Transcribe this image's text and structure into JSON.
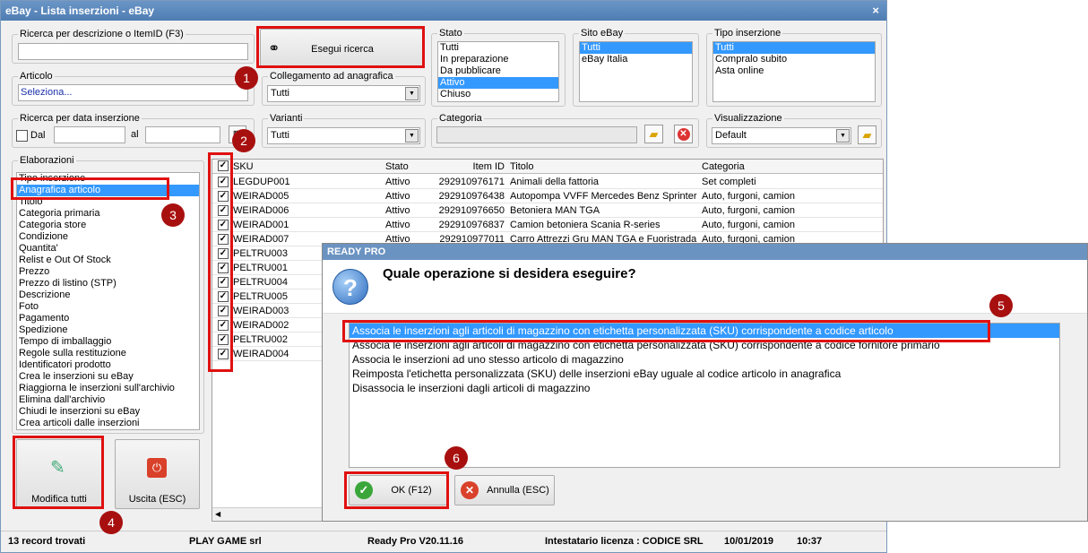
{
  "window": {
    "title": "eBay - Lista inserzioni - eBay",
    "close": "×"
  },
  "search": {
    "desc_label": "Ricerca per descrizione o ItemID (F3)",
    "desc_value": "",
    "exec_button": "Esegui ricerca",
    "articolo_label": "Articolo",
    "articolo_value": "Seleziona...",
    "date_label": "Ricerca per data inserzione",
    "dal_label": "Dal",
    "al_label": "al"
  },
  "collegamento": {
    "label": "Collegamento ad anagrafica",
    "value": "Tutti"
  },
  "varianti": {
    "label": "Varianti",
    "value": "Tutti"
  },
  "stato": {
    "label": "Stato",
    "items": [
      "Tutti",
      "In preparazione",
      "Da pubblicare",
      "Attivo",
      "Chiuso"
    ],
    "selected": 3
  },
  "sito": {
    "label": "Sito eBay",
    "items": [
      "Tutti",
      "eBay Italia"
    ],
    "selected": 0
  },
  "tipo": {
    "label": "Tipo inserzione",
    "items": [
      "Tutti",
      "Compralo subito",
      "Asta online"
    ],
    "selected": 0
  },
  "categoria": {
    "label": "Categoria",
    "value": ""
  },
  "visualizzazione": {
    "label": "Visualizzazione",
    "value": "Default"
  },
  "elaborazioni": {
    "label": "Elaborazioni",
    "items": [
      "Tipo inserzione",
      "Anagrafica articolo",
      "Titolo",
      "Categoria primaria",
      "Categoria store",
      "Condizione",
      "Quantita'",
      "Relist e Out Of Stock",
      "Prezzo",
      "Prezzo di listino (STP)",
      "Descrizione",
      "Foto",
      "Pagamento",
      "Spedizione",
      "Tempo di imballaggio",
      "Regole sulla restituzione",
      "Identificatori prodotto",
      "Crea le inserzioni su eBay",
      "Riaggiorna le inserzioni sull'archivio",
      "Elimina dall'archivio",
      "Chiudi le inserzioni su eBay",
      "Crea articoli dalle inserzioni"
    ],
    "selected": 1
  },
  "buttons": {
    "modifica": "Modifica tutti",
    "uscita": "Uscita (ESC)"
  },
  "grid": {
    "headers": [
      "SKU",
      "Stato",
      "Item ID",
      "Titolo",
      "Categoria"
    ],
    "rows": [
      [
        "LEGDUP001",
        "Attivo",
        "292910976171",
        "Animali della fattoria",
        "Set completi"
      ],
      [
        "WEIRAD005",
        "Attivo",
        "292910976438",
        "Autopompa VVFF Mercedes Benz Sprinter",
        "Auto, furgoni, camion"
      ],
      [
        "WEIRAD006",
        "Attivo",
        "292910976650",
        "Betoniera MAN TGA",
        "Auto, furgoni, camion"
      ],
      [
        "WEIRAD001",
        "Attivo",
        "292910976837",
        "Camion betoniera Scania R-series",
        "Auto, furgoni, camion"
      ],
      [
        "WEIRAD007",
        "Attivo",
        "292910977011",
        "Carro Attrezzi Gru MAN TGA e Fuoristrada",
        "Auto, furgoni, camion"
      ],
      [
        "PELTRU003",
        "",
        "",
        "",
        ""
      ],
      [
        "PELTRU001",
        "",
        "",
        "",
        ""
      ],
      [
        "PELTRU004",
        "",
        "",
        "",
        ""
      ],
      [
        "PELTRU005",
        "",
        "",
        "",
        ""
      ],
      [
        "WEIRAD003",
        "",
        "",
        "",
        ""
      ],
      [
        "WEIRAD002",
        "",
        "",
        "",
        ""
      ],
      [
        "PELTRU002",
        "",
        "",
        "",
        ""
      ],
      [
        "WEIRAD004",
        "",
        "",
        "",
        ""
      ]
    ]
  },
  "status": {
    "records": "13 record trovati",
    "company": "PLAY GAME srl",
    "version": "Ready Pro V20.11.16",
    "license": "Intestatario licenza : CODICE SRL",
    "date": "10/01/2019",
    "time": "10:37"
  },
  "dialog": {
    "title": "READY PRO",
    "question": "Quale operazione si desidera eseguire?",
    "options": [
      "Associa le inserzioni agli articoli di magazzino con etichetta personalizzata (SKU) corrispondente a codice articolo",
      "Associa le inserzioni agli articoli di magazzino con etichetta personalizzata (SKU) corrispondente a codice fornitore primario",
      "Associa le inserzioni ad uno stesso articolo di magazzino",
      "Reimposta l'etichetta personalizzata (SKU) delle inserzioni eBay uguale al codice articolo in anagrafica",
      "Disassocia le inserzioni dagli articoli di magazzino"
    ],
    "selected": 0,
    "ok": "OK (F12)",
    "cancel": "Annulla (ESC)"
  },
  "annotations": [
    "1",
    "2",
    "3",
    "4",
    "5",
    "6"
  ],
  "colors": {
    "highlight": "#e01010",
    "badge": "#a81010",
    "selection": "#3399ff"
  }
}
